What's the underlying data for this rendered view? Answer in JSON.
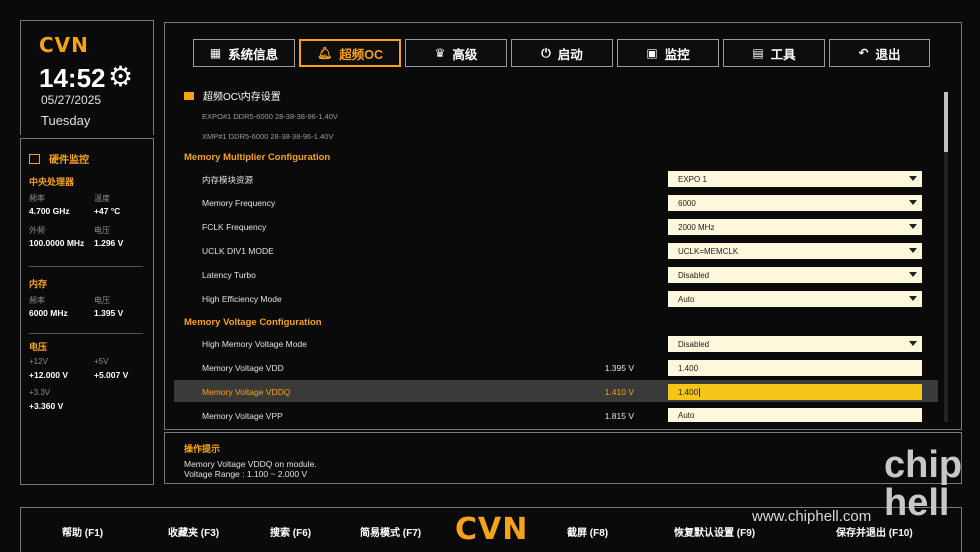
{
  "brand": {
    "logo": "CVN"
  },
  "clock": {
    "time": "14:52",
    "date": "05/27/2025",
    "weekday": "Tuesday"
  },
  "monitor": {
    "title": "硬件监控",
    "cpu": {
      "title": "中央处理器",
      "freq_label": "频率",
      "freq": "4.700 GHz",
      "temp_label": "温度",
      "temp": "+47 °C",
      "bclk_label": "外频",
      "bclk": "100.0000 MHz",
      "volt_label": "电压",
      "volt": "1.296 V"
    },
    "mem": {
      "title": "内存",
      "freq_label": "频率",
      "freq": "6000 MHz",
      "volt_label": "电压",
      "volt": "1.395 V"
    },
    "power": {
      "title": "电压",
      "v12_label": "+12V",
      "v12": "+12.000 V",
      "v5_label": "+5V",
      "v5": "+5.007 V",
      "v33_label": "+3.3V",
      "v33": "+3.360 V"
    }
  },
  "tabs": [
    {
      "label": "系统信息",
      "icon": "grid-icon"
    },
    {
      "label": "超频OC",
      "icon": "bell-icon"
    },
    {
      "label": "高级",
      "icon": "crown-icon"
    },
    {
      "label": "启动",
      "icon": "power-icon"
    },
    {
      "label": "监控",
      "icon": "monitor-icon"
    },
    {
      "label": "工具",
      "icon": "toolbox-icon"
    },
    {
      "label": "退出",
      "icon": "back-arrow-icon"
    }
  ],
  "breadcrumb": "超频OC\\内存设置",
  "profiles": {
    "expo": "EXPO#1  DDR5-6000 28-38-38-96-1.40V",
    "xmp": "XMP#1  DDR5-6000 28-38-38-96-1.40V"
  },
  "sections": {
    "multiplier": "Memory Multiplier Configuration",
    "voltage": "Memory Voltage Configuration"
  },
  "rows": {
    "source": {
      "label": "内存模块资源",
      "value": "EXPO 1"
    },
    "freq": {
      "label": "Memory Frequency",
      "value": "6000"
    },
    "fclk": {
      "label": "FCLK Frequency",
      "value": "2000 MHz"
    },
    "uclk": {
      "label": "UCLK DIV1 MODE",
      "value": "UCLK=MEMCLK"
    },
    "latency": {
      "label": "Latency Turbo",
      "value": "Disabled"
    },
    "higheff": {
      "label": "High Efficiency Mode",
      "value": "Auto"
    },
    "hvmode": {
      "label": "High Memory Voltage Mode",
      "value": "Disabled"
    },
    "vdd": {
      "label": "Memory Voltage VDD",
      "current": "1.395 V",
      "value": "1.400"
    },
    "vddq": {
      "label": "Memory Voltage VDDQ",
      "current": "1.410 V",
      "value": "1.400"
    },
    "vpp": {
      "label": "Memory Voltage VPP",
      "current": "1.815 V",
      "value": "Auto"
    }
  },
  "help": {
    "title": "操作提示",
    "line1": "Memory Voltage VDDQ on module.",
    "line2": "Voltage Range : 1.100 ~ 2.000 V"
  },
  "fkeys": {
    "f1": "帮助 (F1)",
    "f3": "收藏夹 (F3)",
    "f6": "搜索 (F6)",
    "f7": "简易模式 (F7)",
    "f8": "截屏 (F8)",
    "f9": "恢复默认设置 (F9)",
    "f10": "保存并退出 (F10)"
  },
  "watermark": {
    "logo": "chip hell",
    "url": "www.chiphell.com"
  },
  "colors": {
    "accent": "#f5a21b",
    "input_bg": "#fdf7db",
    "active_input": "#f5c518"
  }
}
